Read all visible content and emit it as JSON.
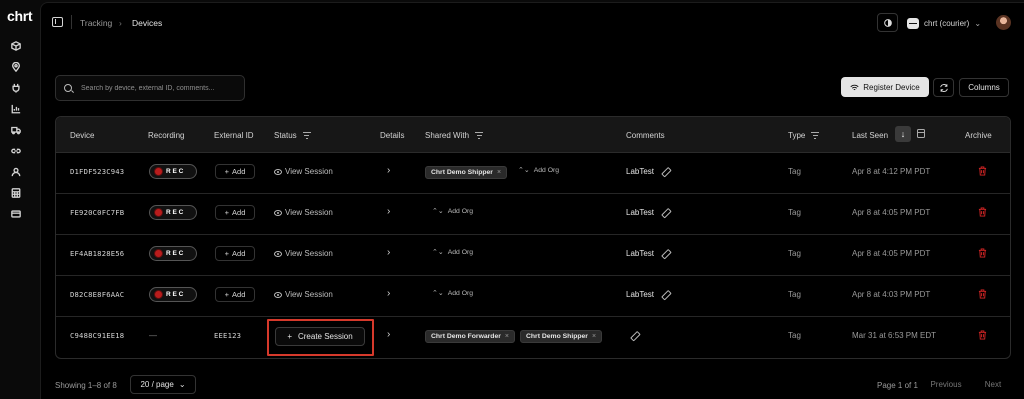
{
  "app": {
    "logo": "chrt"
  },
  "breadcrumb": {
    "parent": "Tracking",
    "separator": "›",
    "current": "Devices"
  },
  "org": {
    "name": "chrt (courier)",
    "chevron": "⌄"
  },
  "search": {
    "placeholder": "Search by device, external ID, comments..."
  },
  "toolbar": {
    "register_label": "Register Device",
    "columns_label": "Columns"
  },
  "table": {
    "headers": {
      "device": "Device",
      "recording": "Recording",
      "external_id": "External ID",
      "status": "Status",
      "details": "Details",
      "shared_with": "Shared With",
      "comments": "Comments",
      "type": "Type",
      "last_seen": "Last Seen",
      "archive": "Archive"
    },
    "rec_label": "REC",
    "add_label": "Add",
    "view_session_label": "View Session",
    "add_org_label": "Add Org",
    "create_session_label": "Create Session",
    "rows": [
      {
        "device": "D1FDF523C943",
        "comment": "LabTest",
        "type": "Tag",
        "last_seen": "Apr 8 at 4:12 PM PDT",
        "shared": [
          "Chrt Demo Shipper"
        ]
      },
      {
        "device": "FE920C0FC7FB",
        "comment": "LabTest",
        "type": "Tag",
        "last_seen": "Apr 8 at 4:05 PM PDT",
        "shared": []
      },
      {
        "device": "EF4AB1828E56",
        "comment": "LabTest",
        "type": "Tag",
        "last_seen": "Apr 8 at 4:05 PM PDT",
        "shared": []
      },
      {
        "device": "D82C8E8F6AAC",
        "comment": "LabTest",
        "type": "Tag",
        "last_seen": "Apr 8 at 4:03 PM PDT",
        "shared": []
      },
      {
        "device": "C9488C91EE18",
        "recording": "—",
        "external_id": "EEE123",
        "comment": "",
        "type": "Tag",
        "last_seen": "Mar 31 at 6:53 PM EDT",
        "shared": [
          "Chrt Demo Forwarder",
          "Chrt Demo Shipper"
        ]
      }
    ]
  },
  "footer": {
    "showing": "Showing 1–8 of 8",
    "page_size": "20 / page",
    "page_info": "Page 1 of 1",
    "prev_label": "Previous",
    "next_label": "Next"
  },
  "colors": {
    "accent_red": "#dc2626",
    "highlight_outline": "#d6392b",
    "background": "#000000"
  }
}
